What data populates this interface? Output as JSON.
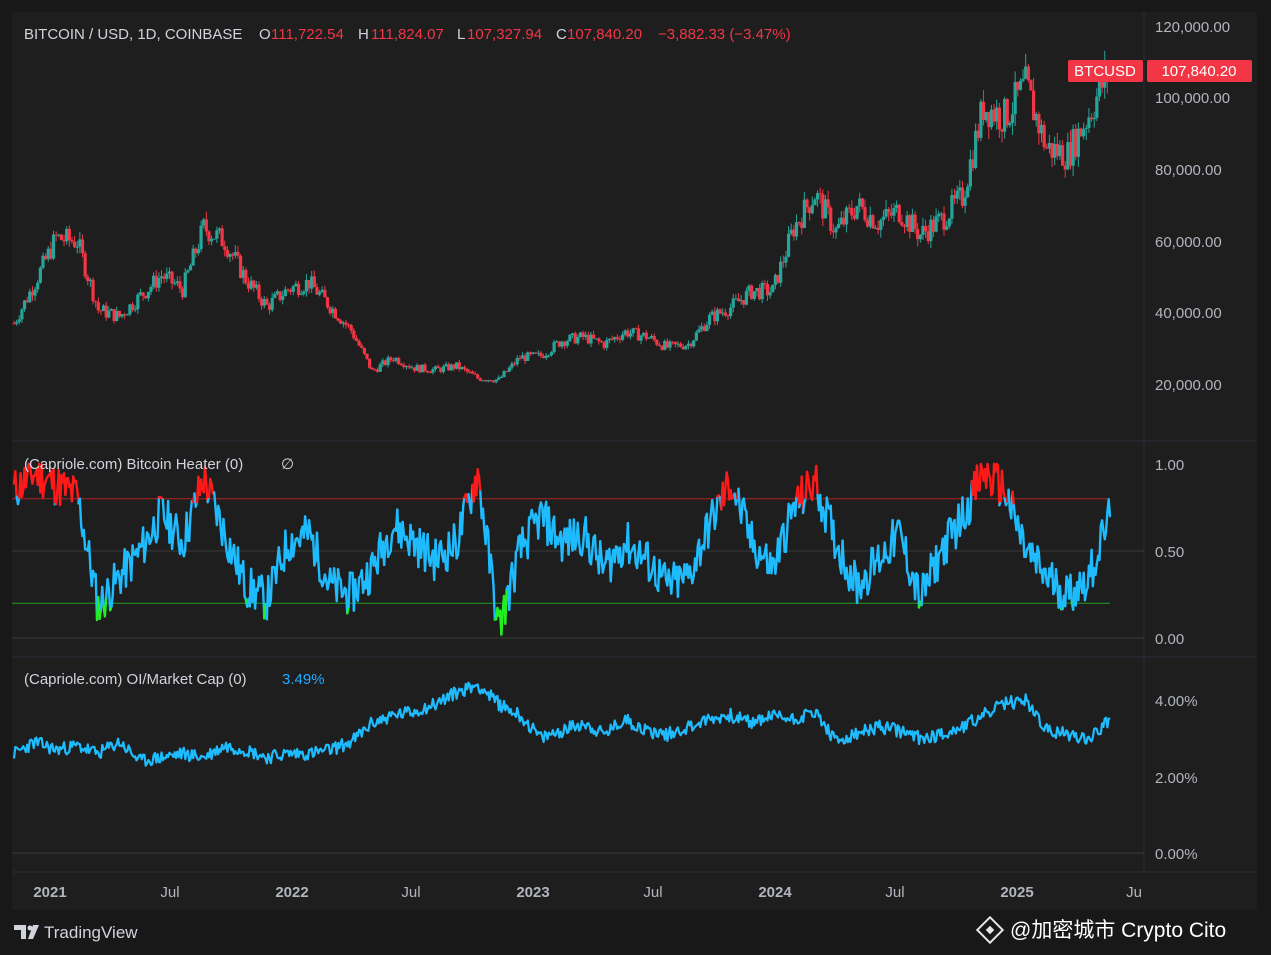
{
  "header": {
    "symbol": "BITCOIN / USD, 1D, COINBASE",
    "o_label": "O",
    "o_value": "111,722.54",
    "h_label": "H",
    "h_value": "111,824.07",
    "l_label": "L",
    "l_value": "107,327.94",
    "c_label": "C",
    "c_value": "107,840.20",
    "change": "−3,882.33 (−3.47%)"
  },
  "price_tag": {
    "ticker": "BTCUSD",
    "price": "107,840.20"
  },
  "heater_legend": {
    "title": "(Capriole.com) Bitcoin Heater (0)",
    "icon": "∅"
  },
  "oi_legend": {
    "title": "(Capriole.com) OI/Market Cap (0)",
    "value": "3.49%"
  },
  "price_axis": [
    "120,000.00",
    "100,000.00",
    "80,000.00",
    "60,000.00",
    "40,000.00",
    "20,000.00"
  ],
  "heater_axis": [
    "1.00",
    "0.50",
    "0.00"
  ],
  "oi_axis": [
    "4.00%",
    "2.00%",
    "0.00%"
  ],
  "time_axis": [
    {
      "label": "2021",
      "bold": true
    },
    {
      "label": "Jul",
      "bold": false
    },
    {
      "label": "2022",
      "bold": true
    },
    {
      "label": "Jul",
      "bold": false
    },
    {
      "label": "2023",
      "bold": true
    },
    {
      "label": "Jul",
      "bold": false
    },
    {
      "label": "2024",
      "bold": true
    },
    {
      "label": "Jul",
      "bold": false
    },
    {
      "label": "2025",
      "bold": true
    },
    {
      "label": "Ju",
      "bold": false
    }
  ],
  "footer": {
    "brand": "TradingView",
    "watermark": "@加密城市 Crypto Cito"
  },
  "colors": {
    "up": "#26a69a",
    "down": "#f23645",
    "heater_line": "#1ebcff",
    "heater_hot": "#ff1a1a",
    "heater_cold": "#22ee22",
    "oi_line": "#1ebcff",
    "upper_band": "#b22222",
    "lower_band": "#1f9d1f"
  },
  "chart_data": [
    {
      "type": "candlestick",
      "title": "BITCOIN / USD, 1D, COINBASE",
      "ylim": [
        10000,
        120000
      ],
      "x": [
        "2021-01",
        "2021-02",
        "2021-03",
        "2021-04",
        "2021-05",
        "2021-06",
        "2021-07",
        "2021-08",
        "2021-09",
        "2021-10",
        "2021-11",
        "2021-12",
        "2022-01",
        "2022-02",
        "2022-03",
        "2022-04",
        "2022-05",
        "2022-06",
        "2022-07",
        "2022-08",
        "2022-09",
        "2022-10",
        "2022-11",
        "2022-12",
        "2023-01",
        "2023-02",
        "2023-03",
        "2023-04",
        "2023-05",
        "2023-06",
        "2023-07",
        "2023-08",
        "2023-09",
        "2023-10",
        "2023-11",
        "2023-12",
        "2024-01",
        "2024-02",
        "2024-03",
        "2024-04",
        "2024-05",
        "2024-06",
        "2024-07",
        "2024-08",
        "2024-09",
        "2024-10",
        "2024-11",
        "2024-12",
        "2025-01",
        "2025-02",
        "2025-03",
        "2025-04",
        "2025-05"
      ],
      "close": [
        33000,
        45000,
        58000,
        57000,
        37000,
        35000,
        41000,
        47000,
        43000,
        61000,
        57000,
        46000,
        38000,
        43000,
        45000,
        38000,
        31000,
        19000,
        23000,
        20000,
        19400,
        20500,
        17000,
        16500,
        23000,
        23500,
        28000,
        29000,
        27000,
        30500,
        29200,
        26000,
        27000,
        34500,
        37700,
        42300,
        42500,
        61000,
        71000,
        60000,
        67500,
        62700,
        66000,
        59000,
        63300,
        70000,
        96500,
        93400,
        102400,
        84300,
        82500,
        94200,
        107840
      ]
    },
    {
      "type": "line",
      "title": "(Capriole.com) Bitcoin Heater (0)",
      "ylim": [
        0,
        1
      ],
      "thresholds": [
        0.8,
        0.2
      ],
      "x": [
        "2021-01",
        "2021-02",
        "2021-03",
        "2021-04",
        "2021-05",
        "2021-06",
        "2021-07",
        "2021-08",
        "2021-09",
        "2021-10",
        "2021-11",
        "2021-12",
        "2022-01",
        "2022-02",
        "2022-03",
        "2022-04",
        "2022-05",
        "2022-06",
        "2022-07",
        "2022-08",
        "2022-09",
        "2022-10",
        "2022-11",
        "2022-12",
        "2023-01",
        "2023-02",
        "2023-03",
        "2023-04",
        "2023-05",
        "2023-06",
        "2023-07",
        "2023-08",
        "2023-09",
        "2023-10",
        "2023-11",
        "2023-12",
        "2024-01",
        "2024-02",
        "2024-03",
        "2024-04",
        "2024-05",
        "2024-06",
        "2024-07",
        "2024-08",
        "2024-09",
        "2024-10",
        "2024-11",
        "2024-12",
        "2025-01",
        "2025-02",
        "2025-03",
        "2025-04",
        "2025-05"
      ],
      "values": [
        0.85,
        0.95,
        0.88,
        0.82,
        0.18,
        0.35,
        0.5,
        0.72,
        0.55,
        0.92,
        0.6,
        0.3,
        0.22,
        0.55,
        0.6,
        0.3,
        0.25,
        0.4,
        0.65,
        0.55,
        0.45,
        0.55,
        0.95,
        0.05,
        0.5,
        0.7,
        0.55,
        0.6,
        0.4,
        0.55,
        0.45,
        0.3,
        0.35,
        0.65,
        0.9,
        0.55,
        0.4,
        0.75,
        0.9,
        0.55,
        0.3,
        0.45,
        0.6,
        0.22,
        0.5,
        0.7,
        0.95,
        0.85,
        0.5,
        0.35,
        0.25,
        0.35,
        0.7
      ]
    },
    {
      "type": "line",
      "title": "(Capriole.com) OI/Market Cap (0)",
      "ylim": [
        0,
        4.8
      ],
      "x": [
        "2021-01",
        "2021-02",
        "2021-03",
        "2021-04",
        "2021-05",
        "2021-06",
        "2021-07",
        "2021-08",
        "2021-09",
        "2021-10",
        "2021-11",
        "2021-12",
        "2022-01",
        "2022-02",
        "2022-03",
        "2022-04",
        "2022-05",
        "2022-06",
        "2022-07",
        "2022-08",
        "2022-09",
        "2022-10",
        "2022-11",
        "2022-12",
        "2023-01",
        "2023-02",
        "2023-03",
        "2023-04",
        "2023-05",
        "2023-06",
        "2023-07",
        "2023-08",
        "2023-09",
        "2023-10",
        "2023-11",
        "2023-12",
        "2024-01",
        "2024-02",
        "2024-03",
        "2024-04",
        "2024-05",
        "2024-06",
        "2024-07",
        "2024-08",
        "2024-09",
        "2024-10",
        "2024-11",
        "2024-12",
        "2025-01",
        "2025-02",
        "2025-03",
        "2025-04",
        "2025-05"
      ],
      "values": [
        2.6,
        2.9,
        2.7,
        2.8,
        2.6,
        2.9,
        2.4,
        2.5,
        2.6,
        2.5,
        2.8,
        2.7,
        2.5,
        2.6,
        2.6,
        2.7,
        2.9,
        3.4,
        3.6,
        3.7,
        3.9,
        4.2,
        4.4,
        3.9,
        3.6,
        3.0,
        3.2,
        3.4,
        3.1,
        3.5,
        3.2,
        3.1,
        3.3,
        3.5,
        3.6,
        3.4,
        3.6,
        3.5,
        3.7,
        2.9,
        3.1,
        3.3,
        3.2,
        3.0,
        3.1,
        3.3,
        3.6,
        3.9,
        4.0,
        3.2,
        3.1,
        3.0,
        3.49
      ]
    }
  ]
}
